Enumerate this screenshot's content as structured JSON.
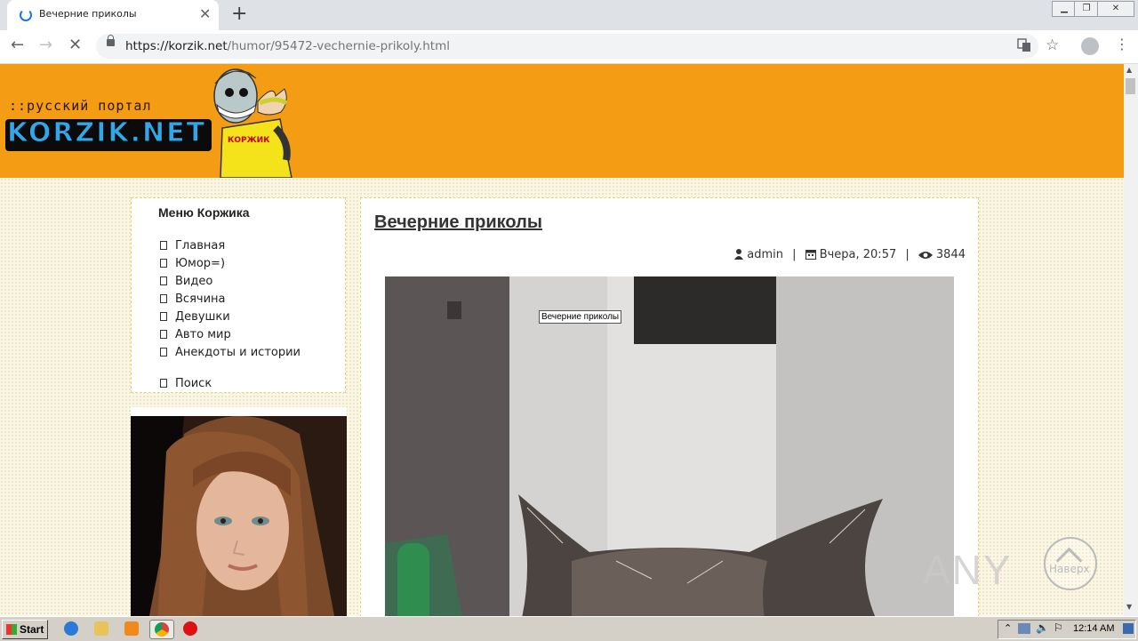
{
  "browser": {
    "tab_title": "Вечерние приколы",
    "url_host": "https://korzik.net",
    "url_path": "/humor/95472-vechernie-prikoly.html"
  },
  "site": {
    "logo_tagline": "::русский портал",
    "logo_name": "KORZIK.NET",
    "mascot_shirt": "КОРЖИК"
  },
  "menu": {
    "title": "Меню Коржика",
    "items": [
      {
        "label": "Главная"
      },
      {
        "label": "Юмор=)"
      },
      {
        "label": "Видео"
      },
      {
        "label": "Всячина"
      },
      {
        "label": "Девушки"
      },
      {
        "label": "Авто мир"
      },
      {
        "label": "Анекдоты и истории"
      }
    ],
    "search_label": "Поиск"
  },
  "article": {
    "title": "Вечерние приколы",
    "author": "admin",
    "date": "Вчера, 20:57",
    "views": "3844",
    "image_tooltip": "Вечерние приколы"
  },
  "overlay": {
    "watermark": "ANY",
    "to_top_label": "Наверх"
  },
  "taskbar": {
    "start_label": "Start",
    "clock": "12:14 AM"
  },
  "colors": {
    "banner": "#f39c14",
    "page_bg": "#fbf7e6",
    "box_border": "#e6d67a",
    "text": "#333333"
  }
}
